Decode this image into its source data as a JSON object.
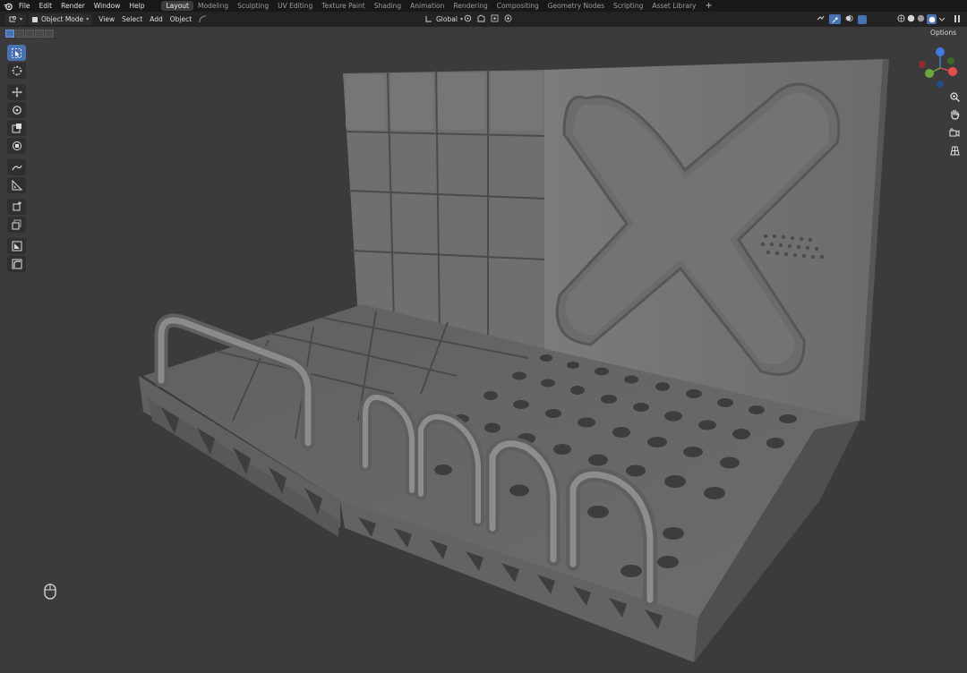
{
  "menu": {
    "items": [
      "File",
      "Edit",
      "Render",
      "Window",
      "Help"
    ]
  },
  "workspaces": {
    "tabs": [
      "Layout",
      "Modeling",
      "Sculpting",
      "UV Editing",
      "Texture Paint",
      "Shading",
      "Animation",
      "Rendering",
      "Compositing",
      "Geometry Nodes",
      "Scripting",
      "Asset Library"
    ],
    "active": "Layout",
    "add_label": "+"
  },
  "header": {
    "mode_label": "Object Mode",
    "view_label": "View",
    "select_label": "Select",
    "add_label": "Add",
    "object_label": "Object",
    "transform_orientation": "Global",
    "options_label": "Options"
  },
  "icons": {
    "logo": "blender-logo-icon",
    "tools": [
      "select-box-icon",
      "cursor-icon",
      "move-icon",
      "rotate-icon",
      "scale-icon",
      "transform-icon",
      "annotate-icon",
      "measure-icon",
      "add-cube-icon",
      "extrude-icon",
      "knife-icon",
      "bevel-icon"
    ],
    "nav": [
      "zoom-icon",
      "pan-hand-icon",
      "camera-icon",
      "grid-icon"
    ],
    "mouse": "mouse-icon"
  },
  "colors": {
    "accent": "#4772b3",
    "axis_x": "#e74c4c",
    "axis_y": "#6ea83a",
    "axis_z": "#3d7be0",
    "viewport_bg": "#3a3a3a",
    "model": "#6f716f"
  }
}
